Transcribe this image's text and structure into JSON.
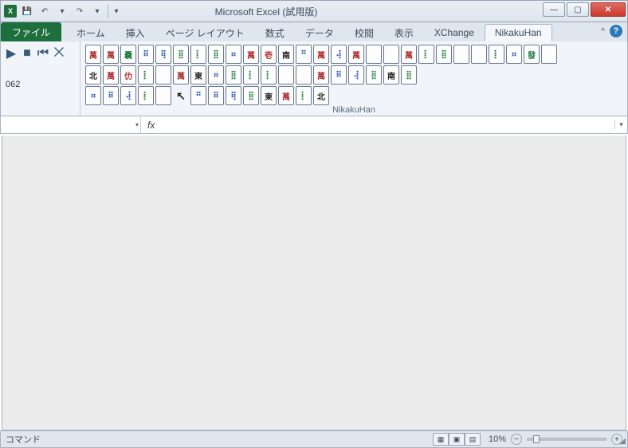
{
  "window": {
    "title": "Microsoft Excel (試用版)",
    "qat": {
      "save": "💾",
      "undo": "↶",
      "redo": "↷",
      "dd": "▾",
      "customize": "▾"
    }
  },
  "ribbon": {
    "file": "ファイル",
    "tabs": [
      "ホーム",
      "挿入",
      "ページ レイアウト",
      "数式",
      "データ",
      "校閲",
      "表示",
      "XChange",
      "NikakuHan"
    ],
    "active_tab": "NikakuHan",
    "minimize": "^",
    "help": "?"
  },
  "group_small": {
    "btns": [
      "▶",
      "■",
      "⏮",
      "⨉"
    ],
    "code": "062"
  },
  "tiles": {
    "label": "NikakuHan",
    "rows": [
      [
        "萬",
        "萬",
        "嚢",
        "⠿",
        "⢿",
        "⣿",
        "⡇",
        "⣿",
        "⠶",
        "萬",
        "壱",
        "南",
        "⠛",
        "萬",
        "⢼",
        "萬",
        "",
        "",
        "萬",
        "⡇",
        "⣿",
        "",
        "",
        "⡇",
        "⠶",
        "發",
        ""
      ],
      [
        "北",
        "萬",
        "仂",
        "⡇",
        "",
        "",
        "",
        "",
        "",
        "萬",
        "東",
        "⠶",
        "⣿",
        "⡇",
        "⡇",
        "",
        "",
        "萬",
        "⠿",
        "⢼",
        "⣿",
        "南",
        "⣿",
        "",
        "",
        ""
      ],
      [
        "⠶",
        "⠿",
        "⢼",
        "⡇",
        "",
        "↖",
        "",
        "",
        "",
        "",
        "",
        "",
        "",
        "",
        "⠛",
        "⠿",
        "⢿",
        "⣿",
        "東",
        "萬",
        "⡇",
        "北",
        "",
        "",
        "",
        ""
      ]
    ],
    "colors": [
      [
        "",
        "",
        "green",
        "blue",
        "blue",
        "green",
        "green",
        "green",
        "blue",
        "",
        "",
        "black",
        "blue",
        "",
        "blue",
        "",
        "empty",
        "empty",
        "",
        "green",
        "green",
        "empty",
        "empty",
        "green",
        "blue",
        "green",
        "empty"
      ],
      [
        "black",
        "",
        "",
        "green",
        "empty",
        "",
        "",
        "",
        "",
        "",
        "black",
        "blue",
        "green",
        "green",
        "green",
        "empty",
        "empty",
        "",
        "blue",
        "blue",
        "green",
        "black",
        "green",
        "",
        "",
        ""
      ],
      [
        "blue",
        "blue",
        "blue",
        "green",
        "empty",
        "black",
        "",
        "",
        "",
        "",
        "",
        "",
        "",
        "",
        "blue",
        "blue",
        "blue",
        "green",
        "black",
        "",
        "green",
        "black",
        "",
        "",
        "",
        ""
      ]
    ]
  },
  "formula": {
    "name_box": "",
    "fx": "fx",
    "value": ""
  },
  "status": {
    "mode": "コマンド",
    "zoom": "10%",
    "view_icons": [
      "▦",
      "▣",
      "▤"
    ]
  }
}
